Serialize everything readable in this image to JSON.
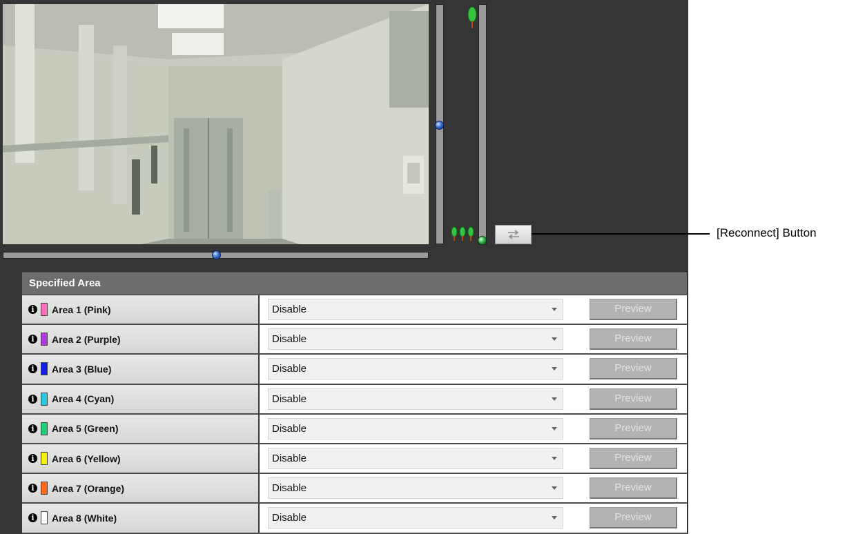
{
  "callout": {
    "label": "[Reconnect] Button"
  },
  "controls": {
    "pan_level": 0.5,
    "tilt_level": 0.5,
    "zoom_level": 0.0,
    "reconnect_icon": "reconnect-arrows-icon"
  },
  "specified_area": {
    "title": "Specified Area",
    "rows": [
      {
        "label": "Area 1 (Pink)",
        "color": "#ff6fb7",
        "value": "Disable",
        "button": "Preview"
      },
      {
        "label": "Area 2 (Purple)",
        "color": "#b23bdb",
        "value": "Disable",
        "button": "Preview"
      },
      {
        "label": "Area 3 (Blue)",
        "color": "#1020e8",
        "value": "Disable",
        "button": "Preview"
      },
      {
        "label": "Area 4 (Cyan)",
        "color": "#29c7e0",
        "value": "Disable",
        "button": "Preview"
      },
      {
        "label": "Area 5 (Green)",
        "color": "#1fd079",
        "value": "Disable",
        "button": "Preview"
      },
      {
        "label": "Area 6 (Yellow)",
        "color": "#f2f20a",
        "value": "Disable",
        "button": "Preview"
      },
      {
        "label": "Area 7 (Orange)",
        "color": "#ff6a1a",
        "value": "Disable",
        "button": "Preview"
      },
      {
        "label": "Area 8 (White)",
        "color": "#ffffff",
        "value": "Disable",
        "button": "Preview"
      }
    ]
  }
}
